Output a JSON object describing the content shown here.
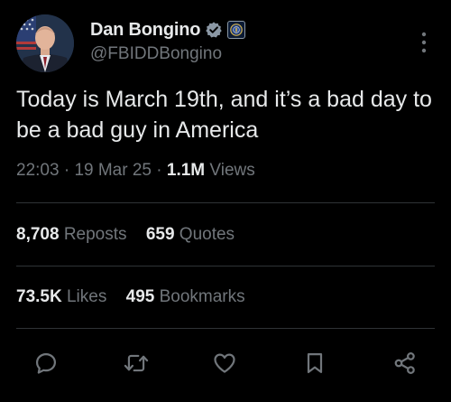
{
  "author": {
    "display_name": "Dan Bongino",
    "handle": "@FBIDDBongino"
  },
  "icons": {
    "verified": "verified-badge-icon",
    "affiliation": "fbi-seal-icon",
    "more": "more-options-icon",
    "reply": "reply-icon",
    "repost": "repost-icon",
    "like": "like-icon",
    "bookmark": "bookmark-icon",
    "share": "share-icon"
  },
  "colors": {
    "background": "#000000",
    "text_primary": "#e7e9ea",
    "text_secondary": "#71767b",
    "divider": "#2f3336",
    "verified_badge": "#8b98a5"
  },
  "tweet": {
    "text": "Today is March 19th, and it’s a bad day to be a bad guy in America",
    "time": "22:03",
    "date": "19 Mar 25",
    "separator": "·",
    "views_count": "1.1M",
    "views_label": "Views"
  },
  "stats": {
    "reposts_count": "8,708",
    "reposts_label": "Reposts",
    "quotes_count": "659",
    "quotes_label": "Quotes",
    "likes_count": "73.5K",
    "likes_label": "Likes",
    "bookmarks_count": "495",
    "bookmarks_label": "Bookmarks"
  }
}
